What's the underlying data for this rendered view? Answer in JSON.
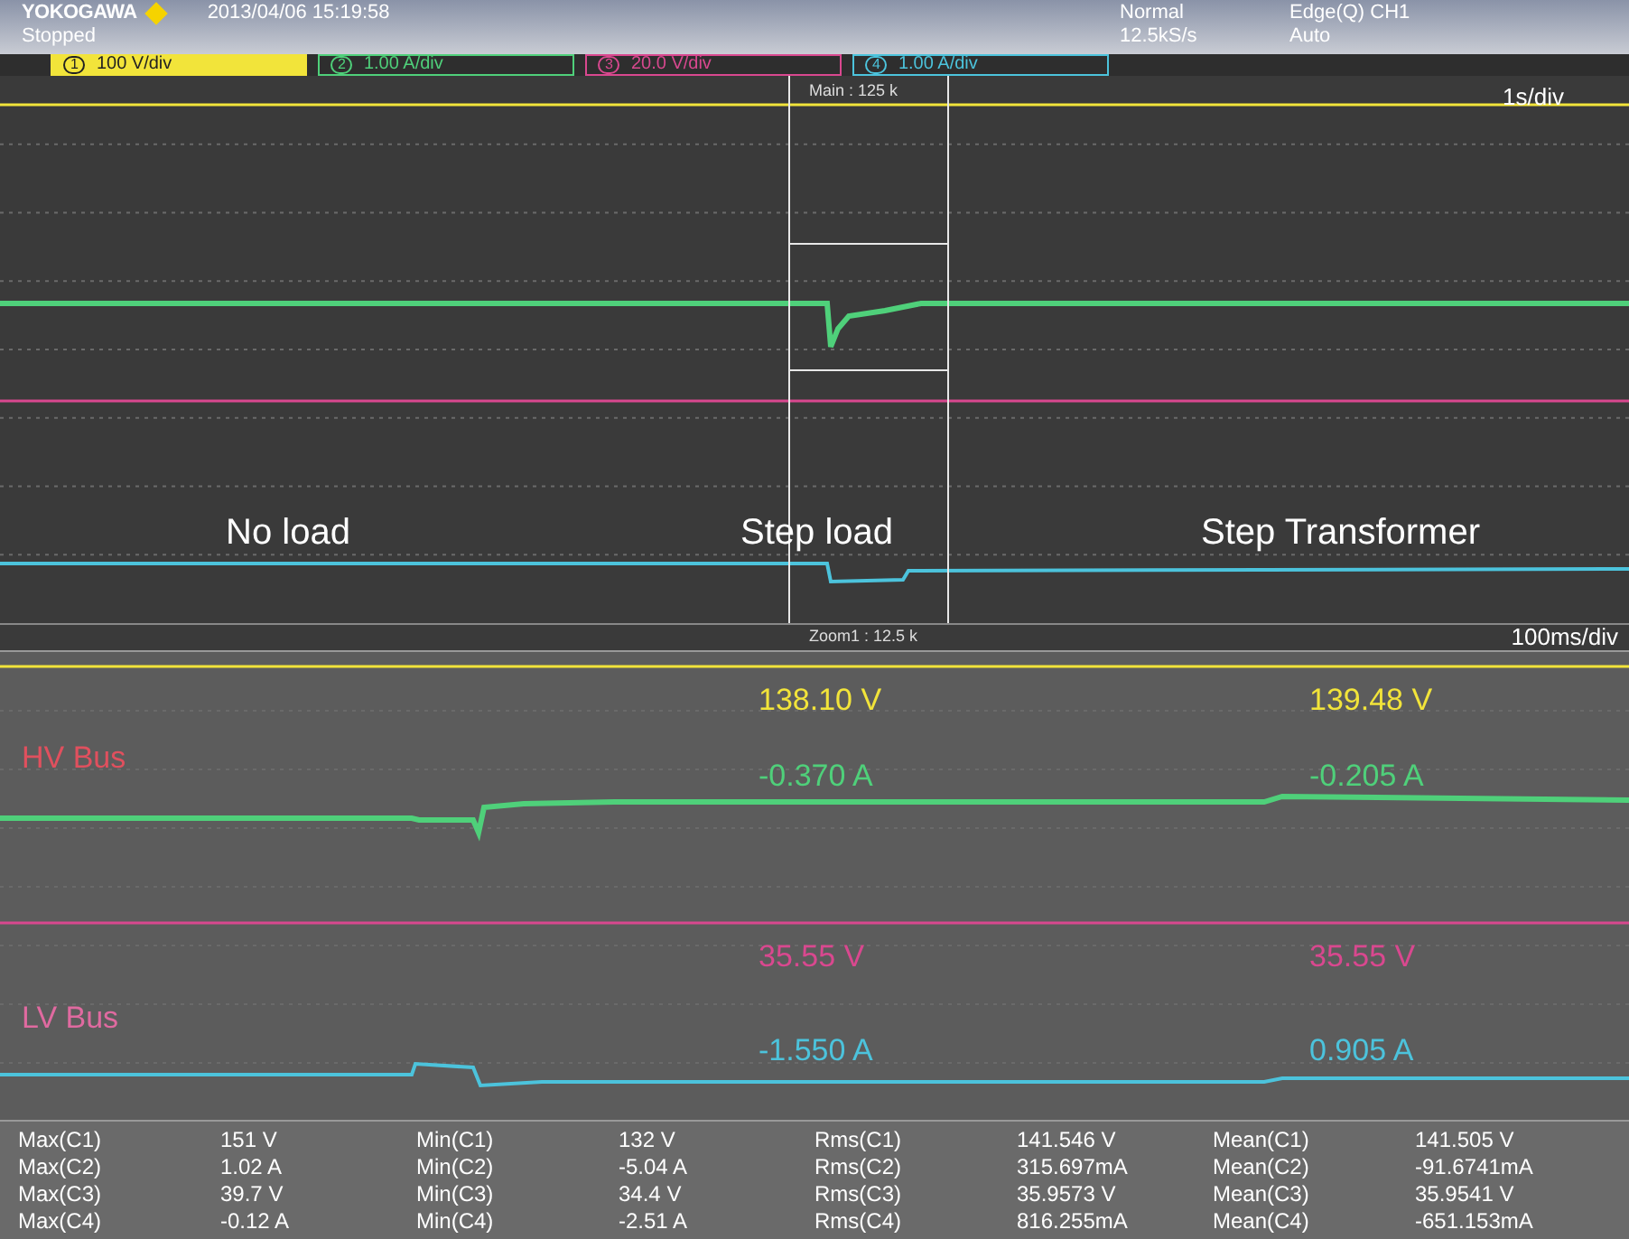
{
  "header": {
    "brand": "YOKOGAWA",
    "timestamp": "2013/04/06 15:19:58",
    "status": "Stopped",
    "mode": "Normal",
    "sample_rate": "12.5kS/s",
    "trigger": "Edge(Q) CH1",
    "trigger_mode": "Auto"
  },
  "channels": [
    {
      "number": "1",
      "scale": "100 V/div",
      "color": "#f2e43a",
      "selected": true
    },
    {
      "number": "2",
      "scale": "1.00 A/div",
      "color": "#4fd07a",
      "selected": false
    },
    {
      "number": "3",
      "scale": "20.0 V/div",
      "color": "#d9488f",
      "selected": false
    },
    {
      "number": "4",
      "scale": "1.00 A/div",
      "color": "#4cc3dc",
      "selected": false
    }
  ],
  "main_window": {
    "zoom_label": "Main : 125 k",
    "timebase": "1s/div",
    "annotations": [
      "No load",
      "Step load",
      "Step Transformer"
    ]
  },
  "zoom_window": {
    "zoom_label": "Zoom1 : 12.5 k",
    "timebase": "100ms/div",
    "bus_labels": [
      {
        "text": "HV Bus",
        "color": "#e0505e"
      },
      {
        "text": "LV Bus",
        "color": "#e06aa0"
      }
    ],
    "readings": [
      [
        "138.10 V",
        "139.48 V"
      ],
      [
        "-0.370 A",
        "-0.205 A"
      ],
      [
        "35.55 V",
        "35.55 V"
      ],
      [
        "-1.550 A",
        "0.905 A"
      ]
    ]
  },
  "measurements": [
    [
      {
        "label": "Max(C1)",
        "value": "151 V"
      },
      {
        "label": "Max(C2)",
        "value": "1.02 A"
      },
      {
        "label": "Max(C3)",
        "value": "39.7 V"
      },
      {
        "label": "Max(C4)",
        "value": "-0.12 A"
      }
    ],
    [
      {
        "label": "Min(C1)",
        "value": "132 V"
      },
      {
        "label": "Min(C2)",
        "value": "-5.04 A"
      },
      {
        "label": "Min(C3)",
        "value": "34.4 V"
      },
      {
        "label": "Min(C4)",
        "value": "-2.51 A"
      }
    ],
    [
      {
        "label": "Rms(C1)",
        "value": "141.546 V"
      },
      {
        "label": "Rms(C2)",
        "value": "315.697mA"
      },
      {
        "label": "Rms(C3)",
        "value": "35.9573 V"
      },
      {
        "label": "Rms(C4)",
        "value": "816.255mA"
      }
    ],
    [
      {
        "label": "Mean(C1)",
        "value": "141.505 V"
      },
      {
        "label": "Mean(C2)",
        "value": "-91.6741mA"
      },
      {
        "label": "Mean(C3)",
        "value": "35.9541 V"
      },
      {
        "label": "Mean(C4)",
        "value": "-651.153mA"
      }
    ]
  ]
}
